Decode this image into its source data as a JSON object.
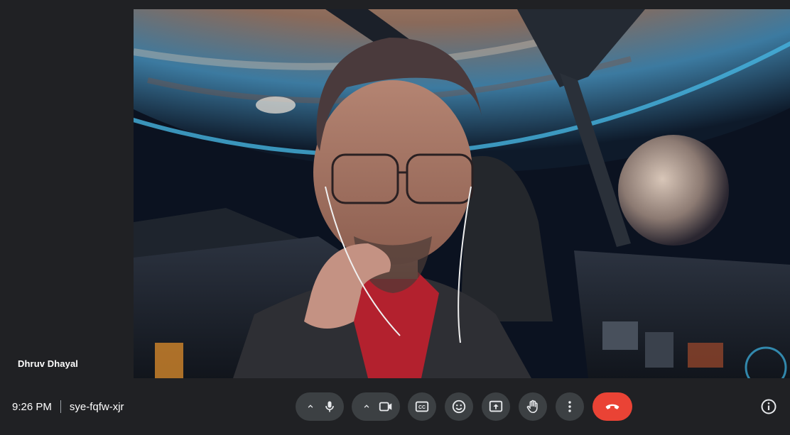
{
  "participant": {
    "name": "Dhruv Dhayal"
  },
  "meeting": {
    "time": "9:26 PM",
    "code": "sye-fqfw-xjr"
  },
  "controls": {
    "mic_options_icon": "chevron-up-icon",
    "mic_icon": "microphone-icon",
    "camera_options_icon": "chevron-up-icon",
    "camera_icon": "video-camera-icon",
    "captions_icon": "closed-captions-icon",
    "reactions_icon": "emoji-icon",
    "present_icon": "present-screen-icon",
    "raise_hand_icon": "hand-icon",
    "more_icon": "more-vertical-icon",
    "leave_icon": "phone-hangup-icon",
    "info_icon": "info-icon"
  },
  "colors": {
    "background": "#202124",
    "control_bg": "#3c4043",
    "hangup": "#ea4335",
    "text": "#ffffff"
  }
}
